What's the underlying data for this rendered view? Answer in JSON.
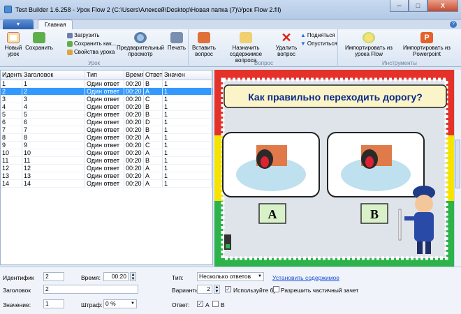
{
  "window": {
    "title": "Test Builder 1.6.258 - Урок Flow 2 (C:\\Users\\Алексей\\Desktop\\Новая папка (7)\\Урок Flow 2.fil)",
    "min": "─",
    "max": "□",
    "close": "X"
  },
  "ribbon_tab": "Главная",
  "help": "?",
  "groups": {
    "lesson": "Урок",
    "question": "Вопрос",
    "tools": "Инструменты"
  },
  "buttons": {
    "new_lesson": "Новый урок",
    "save": "Сохранить",
    "load": "Загрузить",
    "save_as": "Сохранить как...",
    "lesson_props": "Свойства урока",
    "preview": "Предварительный просмотр",
    "print": "Печать",
    "insert_question": "Вставить вопрос",
    "assign_content": "Назначить содержимое вопроса",
    "delete_question": "Удалить вопрос",
    "move_up": "Подняться",
    "move_down": "Опуститься",
    "import_flow": "Импортировать из урока Flow",
    "import_ppt": "Импортировать из Powerpoint"
  },
  "table": {
    "headers": [
      "Идентиф",
      "Заголовок",
      "Тип",
      "Время",
      "Ответ",
      "Значен"
    ],
    "rows": [
      [
        "1",
        "1",
        "Один ответ",
        "00:20",
        "B",
        "1"
      ],
      [
        "2",
        "2",
        "Один ответ",
        "00:20",
        "A",
        "1"
      ],
      [
        "3",
        "3",
        "Один ответ",
        "00:20",
        "C",
        "1"
      ],
      [
        "4",
        "4",
        "Один ответ",
        "00:20",
        "B",
        "1"
      ],
      [
        "5",
        "5",
        "Один ответ",
        "00:20",
        "B",
        "1"
      ],
      [
        "6",
        "6",
        "Один ответ",
        "00:20",
        "D",
        "1"
      ],
      [
        "7",
        "7",
        "Один ответ",
        "00:20",
        "B",
        "1"
      ],
      [
        "8",
        "8",
        "Один ответ",
        "00:20",
        "A",
        "1"
      ],
      [
        "9",
        "9",
        "Один ответ",
        "00:20",
        "C",
        "1"
      ],
      [
        "10",
        "10",
        "Один ответ",
        "00:20",
        "A",
        "1"
      ],
      [
        "11",
        "11",
        "Один ответ",
        "00:20",
        "B",
        "1"
      ],
      [
        "12",
        "12",
        "Один ответ",
        "00:20",
        "A",
        "1"
      ],
      [
        "13",
        "13",
        "Один ответ",
        "00:20",
        "A",
        "1"
      ],
      [
        "14",
        "14",
        "Один ответ",
        "00:20",
        "A",
        "1"
      ]
    ],
    "selected_index": 1
  },
  "slide": {
    "question": "Как правильно переходить дорогу?",
    "answer_a": "A",
    "answer_b": "B",
    "colors": {
      "red": "#e4322b",
      "yellow": "#f6e400",
      "green": "#2db34a",
      "banner": "#fbf4c8"
    }
  },
  "form": {
    "id_label": "Идентифик",
    "id_value": "2",
    "title_label": "Заголовок",
    "title_value": "2",
    "value_label": "Значение:",
    "value_value": "1",
    "time_label": "Время:",
    "time_value": "00:20",
    "penalty_label": "Штраф:",
    "penalty_value": "0 %",
    "type_label": "Тип:",
    "type_value": "Несколько ответов",
    "variants_label": "Варианты:",
    "variants_value": "2",
    "answer_label": "Ответ:",
    "set_content": "Установить содержимое",
    "use_all": "Используйте бу",
    "allow_partial": "Разрешить частичный зачет",
    "answer_a": "A",
    "answer_b": "B"
  }
}
